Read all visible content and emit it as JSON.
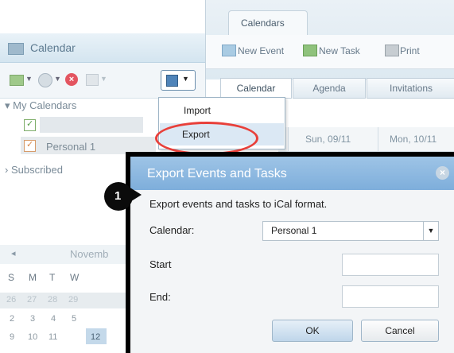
{
  "left_pane": {
    "header_title": "Calendar",
    "my_calendars_label": "▾ My Calendars",
    "calendar_items": [
      "",
      "Personal 1"
    ],
    "subscribed_label": "› Subscribed",
    "mini_calendar": {
      "prev_glyph": "◂",
      "month_label": "Novemb",
      "weekdays": [
        "S",
        "M",
        "T",
        "W"
      ],
      "rows": [
        [
          "26",
          "27",
          "28",
          "29"
        ],
        [
          "2",
          "3",
          "4",
          "5"
        ],
        [
          "9",
          "10",
          "11",
          "12"
        ]
      ]
    }
  },
  "export_menu": {
    "import_label": "Import",
    "export_label": "Export"
  },
  "right_pane": {
    "tab_label": "Calendars",
    "toolbar": {
      "new_event": "New Event",
      "new_task": "New Task",
      "print": "Print"
    },
    "view_tabs": [
      "Calendar",
      "Agenda",
      "Invitations"
    ],
    "dates": [
      "Sun, 09/11",
      "Mon, 10/11"
    ]
  },
  "dialog": {
    "title": "Export Events and Tasks",
    "close_glyph": "×",
    "description": "Export events and tasks to iCal format.",
    "calendar_label": "Calendar:",
    "calendar_value": "Personal 1",
    "start_label": "Start",
    "end_label": "End:",
    "ok_label": "OK",
    "cancel_label": "Cancel"
  },
  "step_number": "1",
  "colors": {
    "dialog_title_bg": "#8cb8e0",
    "highlight_ring": "#e8403a",
    "menu_hover": "#dbe8f4"
  }
}
